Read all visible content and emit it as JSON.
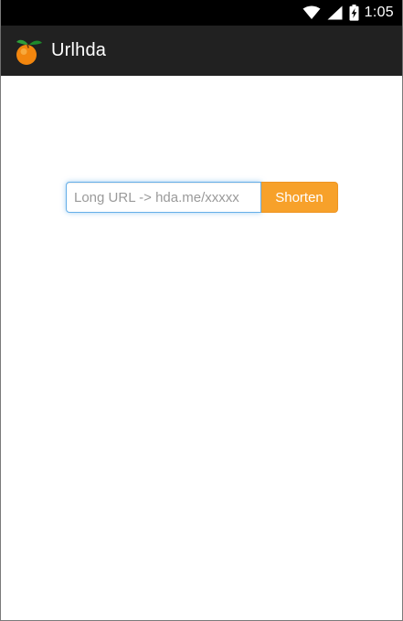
{
  "status_bar": {
    "time": "1:05",
    "icons": [
      "wifi-icon",
      "cellular-signal-icon",
      "battery-charging-icon"
    ]
  },
  "app_bar": {
    "title": "Urlhda",
    "logo_icon": "orange-fruit-icon",
    "background": "#212121"
  },
  "form": {
    "url_input_placeholder": "Long URL -> hda.me/xxxxx",
    "url_input_value": "",
    "shorten_label": "Shorten",
    "accent": "#f7a12a",
    "focus_color": "#66afe9"
  }
}
